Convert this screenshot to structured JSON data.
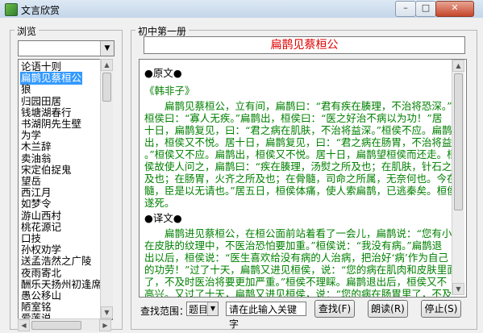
{
  "window": {
    "title": "文言欣赏",
    "buttons": {
      "minimize": "–",
      "maximize": "□",
      "close": "✕"
    }
  },
  "browse": {
    "legend": "浏览",
    "combo_value": "",
    "items": [
      "论语十则",
      "扁鹊见蔡桓公",
      "狼",
      "归园田居",
      "钱塘湖春行",
      "书湖阴先生壁",
      "为学",
      "木兰辞",
      "卖油翁",
      "宋定伯捉鬼",
      "望岳",
      "西江月",
      "如梦令",
      "游山西村",
      "桃花源记",
      "口技",
      "孙权劝学",
      "送孟浩然之广陵",
      "夜雨寄北",
      "酬乐天扬州初逢席上见赠",
      "愚公移山",
      "陋室铭",
      "爱莲说"
    ],
    "selected_index": 1
  },
  "book": {
    "legend": "初中第一册",
    "article_title": "扁鹊见蔡桓公",
    "original_header": "●原文●",
    "source": "《韩非子》",
    "original_lines": [
      "　　扁鹊见蔡桓公，立有间，扁鹊曰：“君有疾在腠理，不治将恐深。”",
      "桓侯曰：“寡人无疾。”扁鹊出，桓侯曰：“医之好治不病以为功！”居",
      "十日，扁鹊复见，曰：“君之病在肌肤，不治将益深。”桓侯不应。扁鹊",
      "出，桓侯又不悦。居十日，扁鹊复见，曰：“君之病在肠胃，不治将益深",
      "。”桓侯又不应。扁鹊出，桓侯又不悦。居十日，扁鹊望桓侯而还走。桓",
      "侯故使人问之，扁鹊曰：“疾在腠理，汤熨之所及也；在肌肤，针石之所",
      "及也；在肠胃，火齐之所及也；在骨髓，司命之所属，无奈何也。今在骨",
      "髓，臣是以无请也。”居五日，桓侯体痛，使人索扁鹊，已逃秦矣。桓侯",
      "遂死。"
    ],
    "translation_header": "●译文●",
    "translation_lines": [
      "　　扁鹊进见蔡桓公，在桓公面前站着看了一会儿，扁鹊说：“您有小病",
      "在皮肤的纹理中，不医治恐怕要加重。”桓侯说：“我没有病。”扁鹊退",
      "出以后，桓侯说：“医生喜欢给没有病的人治病，把治好‘病’作为自己",
      "的功劳！”过了十天，扁鹊又进见桓侯，说：“您的病在肌肉和皮肤里面",
      "了，不及时医治将要更加严重。”桓侯不理睬。扁鹊退出后，桓侯又不",
      "高兴。又过了十天，扁鹊又进见桓侯，说：“您的病在肠胃里了，不及时"
    ]
  },
  "search": {
    "label": "查找范围：",
    "scope_value": "题目",
    "keyword_value": "请在此输入关键字",
    "find_button": "查找(F)",
    "read_button": "朗读(R)",
    "stop_button": "停止(S)"
  }
}
